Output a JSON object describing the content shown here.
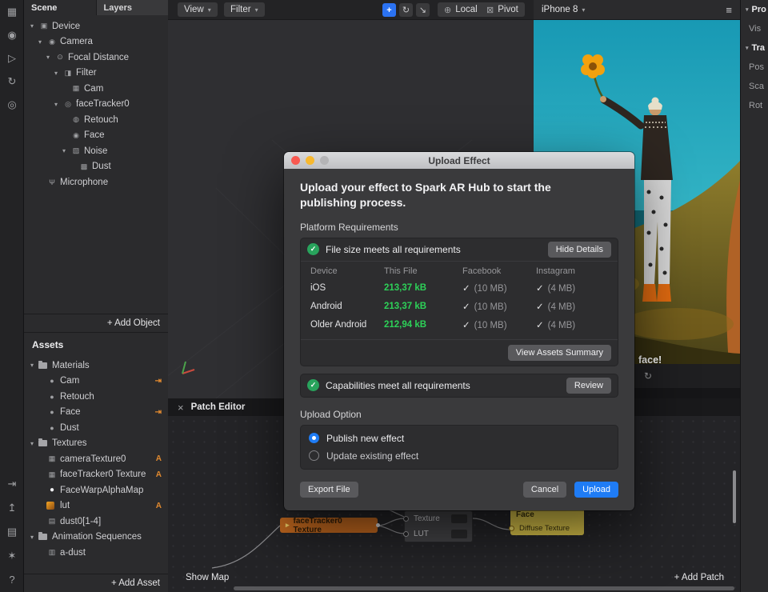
{
  "left_rail": {
    "top_icons": [
      {
        "name": "workspace-grid-icon",
        "glyph": "▦"
      },
      {
        "name": "camera-icon",
        "glyph": "◉"
      },
      {
        "name": "play-icon",
        "glyph": "▷"
      },
      {
        "name": "restart-icon",
        "glyph": "↻"
      },
      {
        "name": "zoom-icon",
        "glyph": "◎"
      }
    ],
    "bottom_icons": [
      {
        "name": "send-to-device-icon",
        "glyph": "⇥"
      },
      {
        "name": "export-icon",
        "glyph": "↥"
      },
      {
        "name": "archive-icon",
        "glyph": "▤"
      },
      {
        "name": "bug-icon",
        "glyph": "✶"
      },
      {
        "name": "help-icon",
        "glyph": "?"
      }
    ]
  },
  "scene_panel": {
    "tabs": {
      "scene": "Scene",
      "layers": "Layers"
    },
    "tree": [
      {
        "label": "Device",
        "glyph": "▣",
        "arrow": "▾"
      },
      {
        "label": "Camera",
        "glyph": "◉",
        "arrow": "▾"
      },
      {
        "label": "Focal Distance",
        "glyph": "⊙",
        "arrow": "▾"
      },
      {
        "label": "Filter",
        "glyph": "◨",
        "arrow": "▾"
      },
      {
        "label": "Cam",
        "glyph": "▦",
        "arrow": ""
      },
      {
        "label": "faceTracker0",
        "glyph": "◎",
        "arrow": "▾"
      },
      {
        "label": "Retouch",
        "glyph": "◍",
        "arrow": ""
      },
      {
        "label": "Face",
        "glyph": "◉",
        "arrow": ""
      },
      {
        "label": "Noise",
        "glyph": "▨",
        "arrow": "▾"
      },
      {
        "label": "Dust",
        "glyph": "▩",
        "arrow": ""
      },
      {
        "label": "Microphone",
        "glyph": "Ψ",
        "arrow": ""
      }
    ],
    "add_object": "+ Add Object"
  },
  "assets_panel": {
    "title": "Assets",
    "tree": [
      {
        "label": "Materials",
        "arrow": "▾"
      },
      {
        "label": "Cam",
        "glyph": "●",
        "trail": "⇥"
      },
      {
        "label": "Retouch",
        "glyph": "●",
        "trail": ""
      },
      {
        "label": "Face",
        "glyph": "●",
        "trail": "⇥"
      },
      {
        "label": "Dust",
        "glyph": "●",
        "trail": ""
      },
      {
        "label": "Textures",
        "arrow": "▾"
      },
      {
        "label": "cameraTexture0",
        "glyph": "▦",
        "trail": "A"
      },
      {
        "label": "faceTracker0 Texture",
        "glyph": "▦",
        "trail": "A"
      },
      {
        "label": "FaceWarpAlphaMap",
        "glyph": "●",
        "trail": ""
      },
      {
        "label": "lut",
        "trail": "A"
      },
      {
        "label": "dust0[1-4]",
        "glyph": "▤",
        "trail": ""
      },
      {
        "label": "Animation Sequences",
        "arrow": "▾"
      },
      {
        "label": "a-dust",
        "glyph": "▥",
        "trail": ""
      }
    ],
    "add_asset": "+ Add Asset"
  },
  "toolbar": {
    "view": "View",
    "filter": "Filter",
    "chevron": "▾",
    "move_glyph": "+",
    "rotate_glyph": "↻",
    "scale_glyph": "↘",
    "globe_glyph": "⊕",
    "local": "Local",
    "pivot_glyph": "⊠",
    "pivot": "Pivot"
  },
  "preview": {
    "device": "iPhone 8",
    "chevron": "▾",
    "menu_glyph": "≡",
    "caption": "face!",
    "bar_glyph": "↻"
  },
  "right_strip": {
    "items": [
      {
        "label": "Pro",
        "arrow": "▾"
      },
      {
        "label": "Vis",
        "arrow": ""
      },
      {
        "label": "Tra",
        "arrow": "▾"
      },
      {
        "label": "Pos",
        "arrow": ""
      },
      {
        "label": "Sca",
        "arrow": ""
      },
      {
        "label": "Rot",
        "arrow": ""
      }
    ]
  },
  "modal": {
    "title": "Upload Effect",
    "heading": "Upload your effect to Spark AR Hub to start the publishing process.",
    "platform_requirements": "Platform Requirements",
    "file_size_status": "File size meets all requirements",
    "hide_details": "Hide Details",
    "check": "✓",
    "table": {
      "headers": [
        "Device",
        "This File",
        "Facebook",
        "Instagram"
      ],
      "rows": [
        {
          "device": "iOS",
          "size": "213,37 kB",
          "fb": "(10 MB)",
          "ig": "(4 MB)"
        },
        {
          "device": "Android",
          "size": "213,37 kB",
          "fb": "(10 MB)",
          "ig": "(4 MB)"
        },
        {
          "device": "Older Android",
          "size": "212,94 kB",
          "fb": "(10 MB)",
          "ig": "(4 MB)"
        }
      ]
    },
    "view_assets_summary": "View Assets Summary",
    "capabilities_status": "Capabilities meet all requirements",
    "review": "Review",
    "upload_option": "Upload Option",
    "options": [
      {
        "label": "Publish new effect",
        "selected": true
      },
      {
        "label": "Update existing effect",
        "selected": false
      }
    ],
    "export_file": "Export File",
    "cancel": "Cancel",
    "upload": "Upload"
  },
  "patch_editor": {
    "close_glyph": "×",
    "title": "Patch Editor",
    "show_map": "Show Map",
    "add_patch": "+ Add Patch",
    "patches": {
      "face_tracker_texture": {
        "arrow": "▸",
        "label": "faceTracker0 Texture"
      },
      "lut_patch": {
        "inputs": [
          "Texture",
          "LUT"
        ]
      },
      "face_material": {
        "title": "Face",
        "input": "Diffuse Texture"
      }
    }
  },
  "colors": {
    "accent_blue": "#1f7cf5",
    "success_green": "#2dd158",
    "asset_orange": "#e0892f",
    "patch_orange": "#c4691f",
    "patch_yellow": "#d9c34a",
    "sky_teal": "#2fb0c2"
  }
}
